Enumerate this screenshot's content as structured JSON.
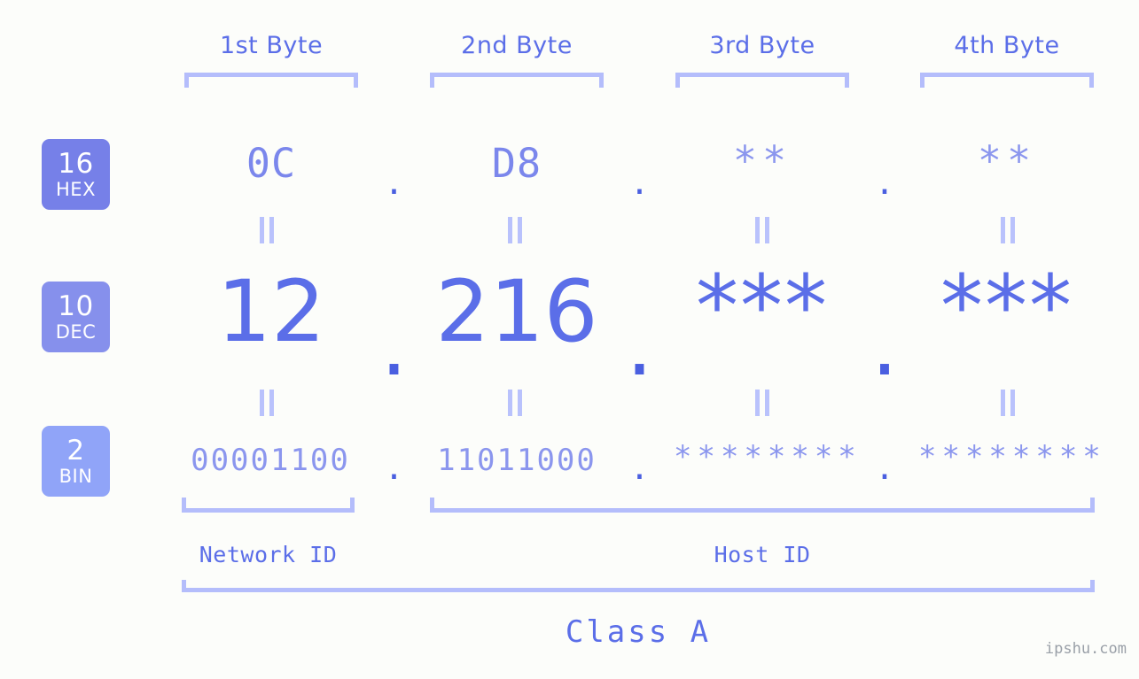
{
  "background_color": "#fcfdfa",
  "accent_color": "#5b6ee8",
  "accent_light_color": "#8b96ee",
  "bracket_color": "#b4bdfb",
  "headers": [
    {
      "label": "1st Byte"
    },
    {
      "label": "2nd Byte"
    },
    {
      "label": "3rd Byte"
    },
    {
      "label": "4th Byte"
    }
  ],
  "bases": [
    {
      "number": "16",
      "name": "HEX",
      "color": "#7680e8"
    },
    {
      "number": "10",
      "name": "DEC",
      "color": "#8690ec"
    },
    {
      "number": "2",
      "name": "BIN",
      "color": "#90a4f8"
    }
  ],
  "rows": {
    "hex": {
      "byte1": "0C",
      "byte2": "D8",
      "byte3": "**",
      "byte4": "**",
      "separator": "."
    },
    "dec": {
      "byte1": "12",
      "byte2": "216",
      "byte3": "***",
      "byte4": "***",
      "separator": "."
    },
    "bin": {
      "byte1": "00001100",
      "byte2": "11011000",
      "byte3": "********",
      "byte4": "********",
      "separator": "."
    }
  },
  "equals_symbol": "||",
  "segments": {
    "network_id": "Network ID",
    "host_id": "Host ID"
  },
  "class_label": "Class A",
  "watermark": "ipshu.com"
}
